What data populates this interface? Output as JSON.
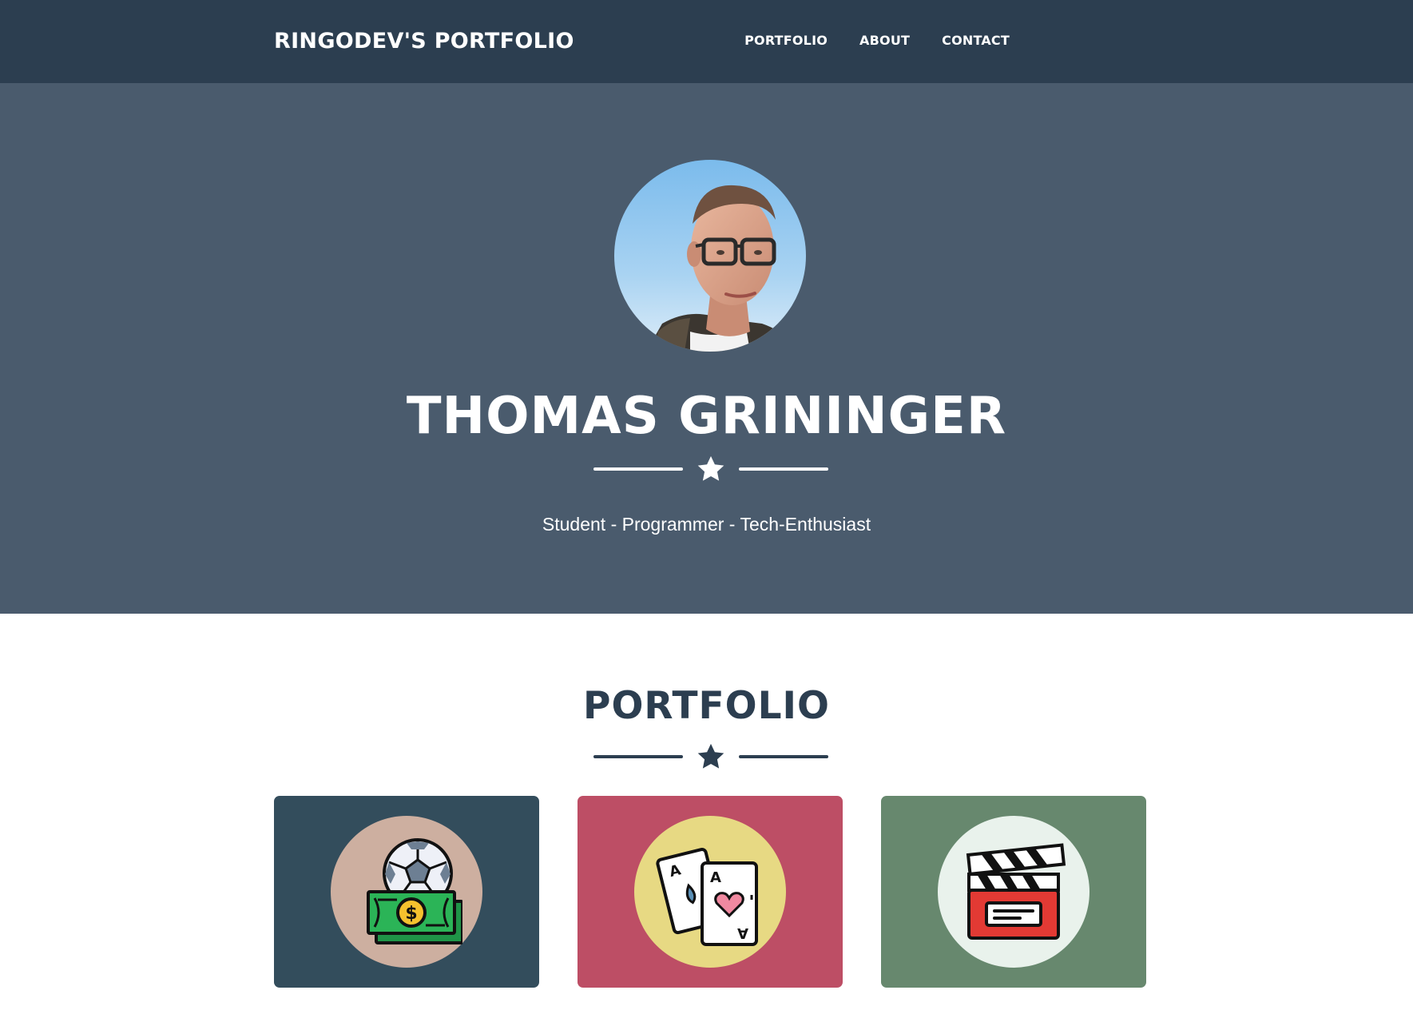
{
  "navbar": {
    "brand": "RINGODEV'S PORTFOLIO",
    "links": [
      {
        "label": "PORTFOLIO"
      },
      {
        "label": "ABOUT"
      },
      {
        "label": "CONTACT"
      }
    ]
  },
  "hero": {
    "name": "THOMAS GRININGER",
    "tagline": "Student - Programmer - Tech-Enthusiast",
    "avatar_icon": "profile-photo",
    "divider_icon": "star-icon"
  },
  "portfolio": {
    "title": "PORTFOLIO",
    "divider_icon": "star-icon",
    "items": [
      {
        "icon": "soccer-money-icon",
        "card_color": "#334d5c",
        "circle_color": "#cdafa0"
      },
      {
        "icon": "playing-cards-icon",
        "card_color": "#bd4e65",
        "circle_color": "#e7d983"
      },
      {
        "icon": "clapperboard-icon",
        "card_color": "#67886e",
        "circle_color": "#e9f2ec"
      }
    ]
  },
  "colors": {
    "navbar_bg": "#2c3e50",
    "hero_bg": "#4a5b6d",
    "heading": "#2c3e50"
  }
}
